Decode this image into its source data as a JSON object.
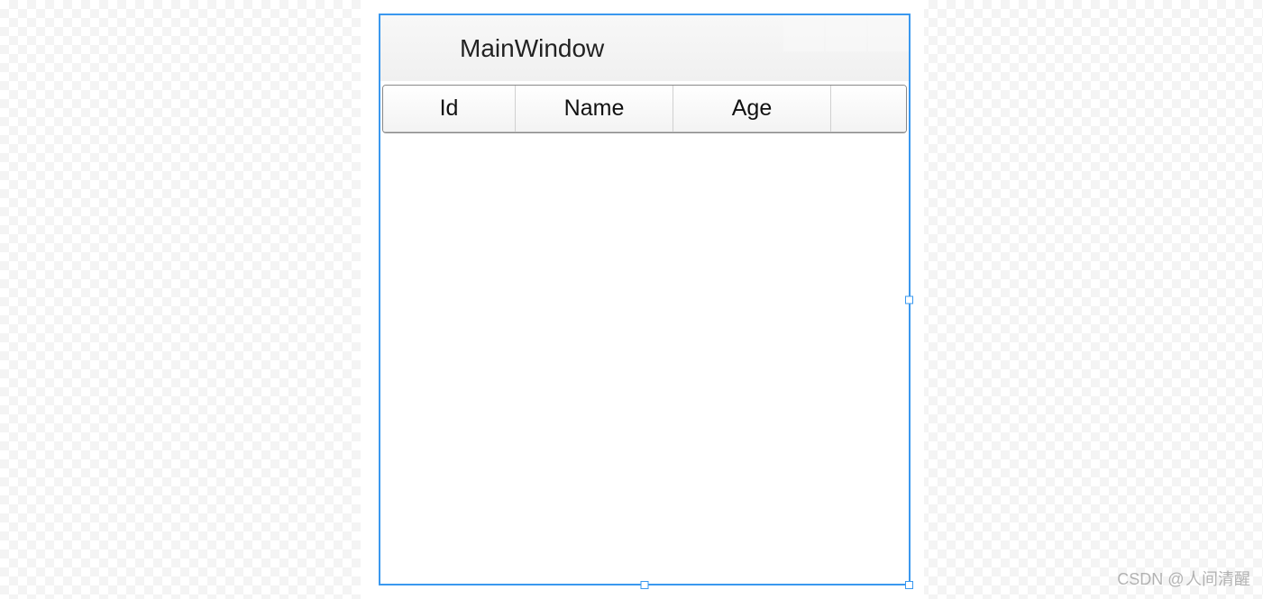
{
  "window": {
    "title": "MainWindow"
  },
  "datagrid": {
    "columns": [
      {
        "header": "Id"
      },
      {
        "header": "Name"
      },
      {
        "header": "Age"
      }
    ],
    "rows": []
  },
  "watermark": "CSDN @ 人间清醒"
}
